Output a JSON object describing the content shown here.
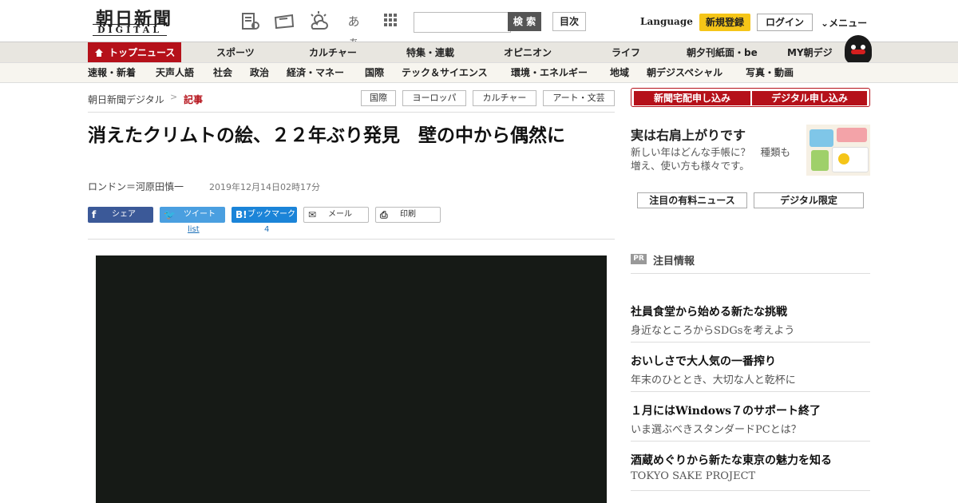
{
  "header": {
    "logo_main": "朝日新聞",
    "logo_sub": "DIGITAL",
    "icons": [
      "paper-icon",
      "ticket-icon",
      "weather-icon",
      "font-size-icon",
      "grid-icon"
    ],
    "font_size_glyph": "あぁ",
    "search": {
      "placeholder": "",
      "button": "検 索"
    },
    "toc": "目次",
    "language": "Language",
    "register": "新規登録",
    "login": "ログイン",
    "menu": "メニュー"
  },
  "nav_primary": {
    "active": "トップニュース",
    "items": [
      "スポーツ",
      "カルチャー",
      "特集・連載",
      "オピニオン",
      "ライフ",
      "朝夕刊紙面・be",
      "MY朝デジ"
    ]
  },
  "nav_secondary": {
    "items": [
      "速報・新着",
      "天声人語",
      "社会",
      "政治",
      "経済・マネー",
      "国際",
      "テック＆サイエンス",
      "環境・エネルギー",
      "地域",
      "朝デジスペシャル",
      "写真・動画"
    ]
  },
  "breadcrumb": {
    "home": "朝日新聞デジタル",
    "sep": ">",
    "current": "記事"
  },
  "tags": [
    "国際",
    "ヨーロッパ",
    "カルチャー",
    "アート・文芸"
  ],
  "article": {
    "headline": "消えたクリムトの絵、２２年ぶり発見　壁の中から偶然に",
    "byline": "ロンドン＝河原田慎一",
    "date": "2019年12月14日02時17分"
  },
  "share": {
    "facebook": "シェア",
    "twitter": "ツイート",
    "twitter_sub": "list",
    "hatena": "ブックマーク",
    "hatena_count": "4",
    "mail": "メール",
    "print": "印刷"
  },
  "sidebar": {
    "order_paper": "新聞宅配申し込み",
    "order_digital": "デジタル申し込み",
    "promo": {
      "title": "実は右肩上がりです",
      "text": "新しい年はどんな手帳に？　種類も増え、使い方も様々です。"
    },
    "buttons": [
      "注目の有料ニュース",
      "デジタル限定"
    ],
    "pr": {
      "badge": "PR",
      "title": "注目情報",
      "items": [
        {
          "title": "社員食堂から始める新たな挑戦",
          "sub": "身近なところからSDGsを考えよう"
        },
        {
          "title": "おいしさで大人気の一番搾り",
          "sub": "年末のひととき、大切な人と乾杯に"
        },
        {
          "title": "１月にはWindows７のサポート終了",
          "sub": "いま選ぶべきスタンダードPCとは？"
        },
        {
          "title": "酒蔵めぐりから新たな東京の魅力を知る",
          "sub": "TOKYO SAKE PROJECT"
        }
      ]
    }
  },
  "colors": {
    "brand_red": "#b5111a",
    "register_yellow": "#f5c518",
    "facebook": "#3b5998",
    "twitter": "#4a9fe0",
    "hatena": "#1b84d8"
  }
}
